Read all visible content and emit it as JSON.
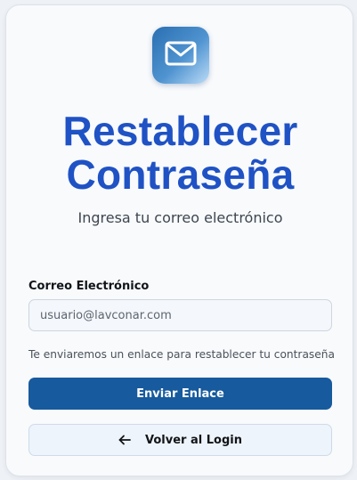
{
  "header": {
    "logo_icon": "mail-icon",
    "title": "Restablecer Contraseña",
    "subtitle": "Ingresa tu correo electrónico"
  },
  "form": {
    "email_label": "Correo Electrónico",
    "email_placeholder": "usuario@lavconar.com",
    "email_value": "",
    "hint": "Te enviaremos un enlace para restablecer tu contraseña",
    "submit_label": "Enviar Enlace",
    "back_label": "Volver al Login",
    "back_icon": "arrow-left-icon"
  },
  "colors": {
    "title": "#1f52c4",
    "primary_button": "#175a9d",
    "secondary_button": "#eef4fb"
  }
}
